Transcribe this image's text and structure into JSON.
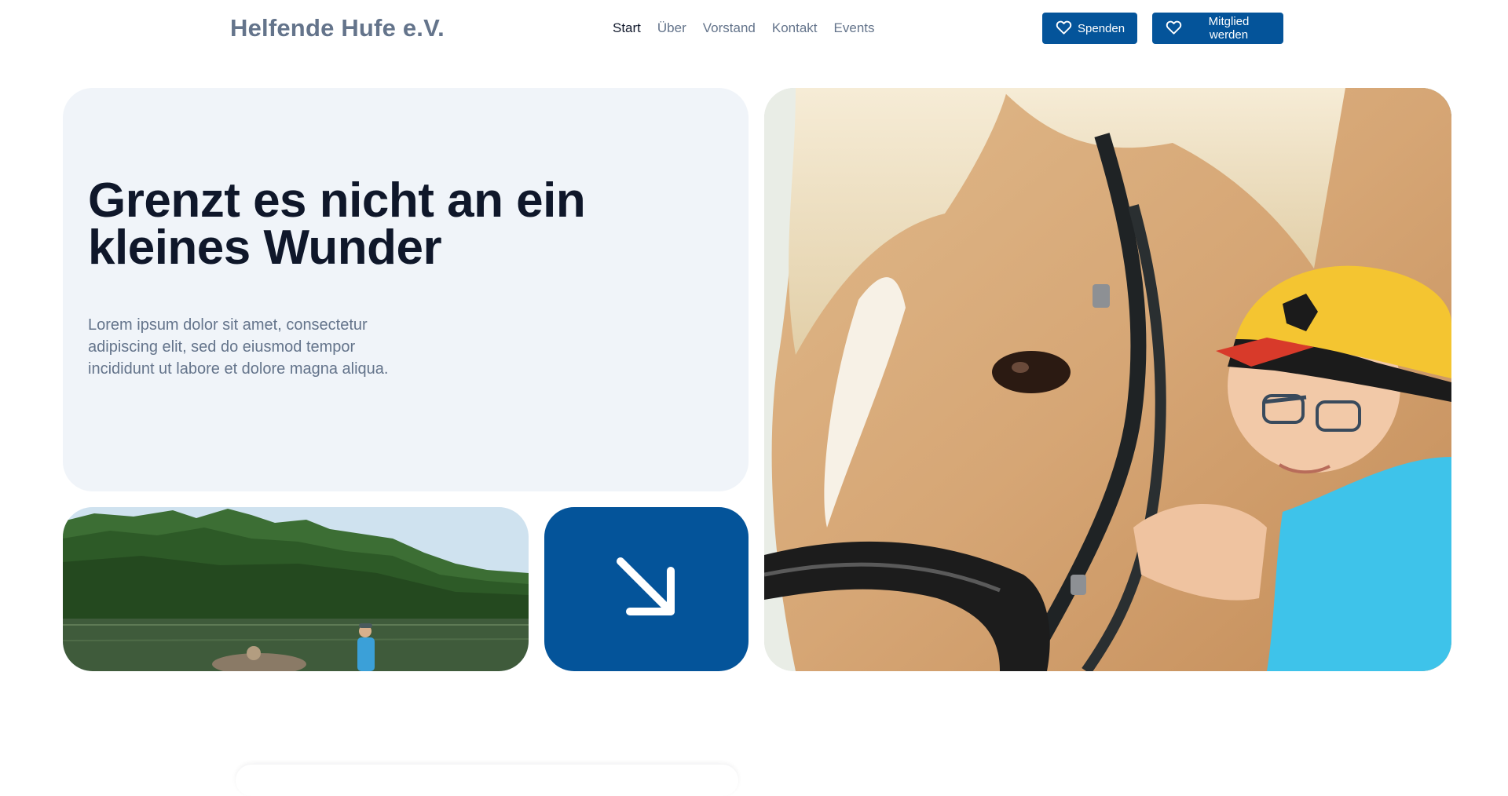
{
  "header": {
    "logo": "Helfende Hufe e.V.",
    "nav": [
      {
        "label": "Start",
        "active": true
      },
      {
        "label": "Über",
        "active": false
      },
      {
        "label": "Vorstand",
        "active": false
      },
      {
        "label": "Kontakt",
        "active": false
      },
      {
        "label": "Events",
        "active": false
      }
    ],
    "donate_label": "Spenden",
    "member_label": "Mitglied werden",
    "button_icon": "heart-icon"
  },
  "hero": {
    "title": "Grenzt es nicht an ein kleines Wunder",
    "text": "Lorem ipsum dolor sit amet, consectetur adipiscing elit, sed do eiusmod tempor incididunt ut labore et dolore magna aliqua.",
    "arrow_icon": "arrow-down-right-icon"
  },
  "colors": {
    "brand": "#04549a",
    "card_bg": "#f0f4f9",
    "heading": "#0f172a",
    "muted": "#64748b"
  }
}
